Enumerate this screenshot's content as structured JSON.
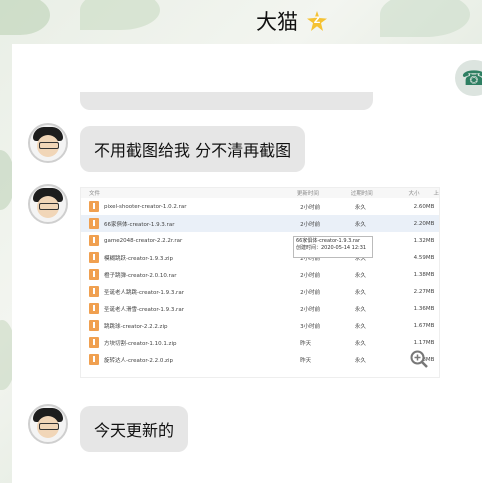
{
  "header": {
    "title": "大猫",
    "badge": "Z"
  },
  "messages": [
    {
      "text": "不用截图给我 分不清再截图"
    },
    {
      "text": "今天更新的"
    }
  ],
  "screenshot": {
    "columns": [
      "文件",
      "更新时间",
      "过期时间",
      "大小",
      "上"
    ],
    "rows": [
      {
        "name": "pixel-shooter-creator-1.0.2.rar",
        "time": "2小时前",
        "expire": "永久",
        "size": "2.60MB"
      },
      {
        "name": "66家俱体-creator-1.9.3.rar",
        "time": "2小时前",
        "expire": "永久",
        "size": "2.20MB"
      },
      {
        "name": "game2048-creator-2.2.2r.rar",
        "time": "2小时前",
        "expire": "永久",
        "size": "1.32MB"
      },
      {
        "name": "模糊跳跃-creator-1.9.3.zip",
        "time": "2小时前",
        "expire": "永久",
        "size": "4.59MB"
      },
      {
        "name": "橙子跳弹-creator-2.0.10.rar",
        "time": "2小时前",
        "expire": "永久",
        "size": "1.38MB"
      },
      {
        "name": "圣诞老人跳跳-creator-1.9.3.rar",
        "time": "2小时前",
        "expire": "永久",
        "size": "2.27MB"
      },
      {
        "name": "圣诞老人滑雪-creator-1.9.3.rar",
        "time": "2小时前",
        "expire": "永久",
        "size": "1.36MB"
      },
      {
        "name": "跳跳球-creator-2.2.2.zip",
        "time": "3小时前",
        "expire": "永久",
        "size": "1.67MB"
      },
      {
        "name": "方块切割-creator-1.10.1.zip",
        "time": "昨天",
        "expire": "永久",
        "size": "1.17MB"
      },
      {
        "name": "旋转达人-creator-2.2.0.zip",
        "time": "昨天",
        "expire": "永久",
        "size": "1.28MB"
      }
    ],
    "tooltip_line1": "66家俱体-creator-1.9.3.rar",
    "tooltip_line2": "创建时间：2020-05-14 12:31"
  },
  "icons": {
    "star": "star-icon",
    "phone": "phone-icon",
    "zoom": "zoom-in-icon",
    "file": "file-icon"
  }
}
